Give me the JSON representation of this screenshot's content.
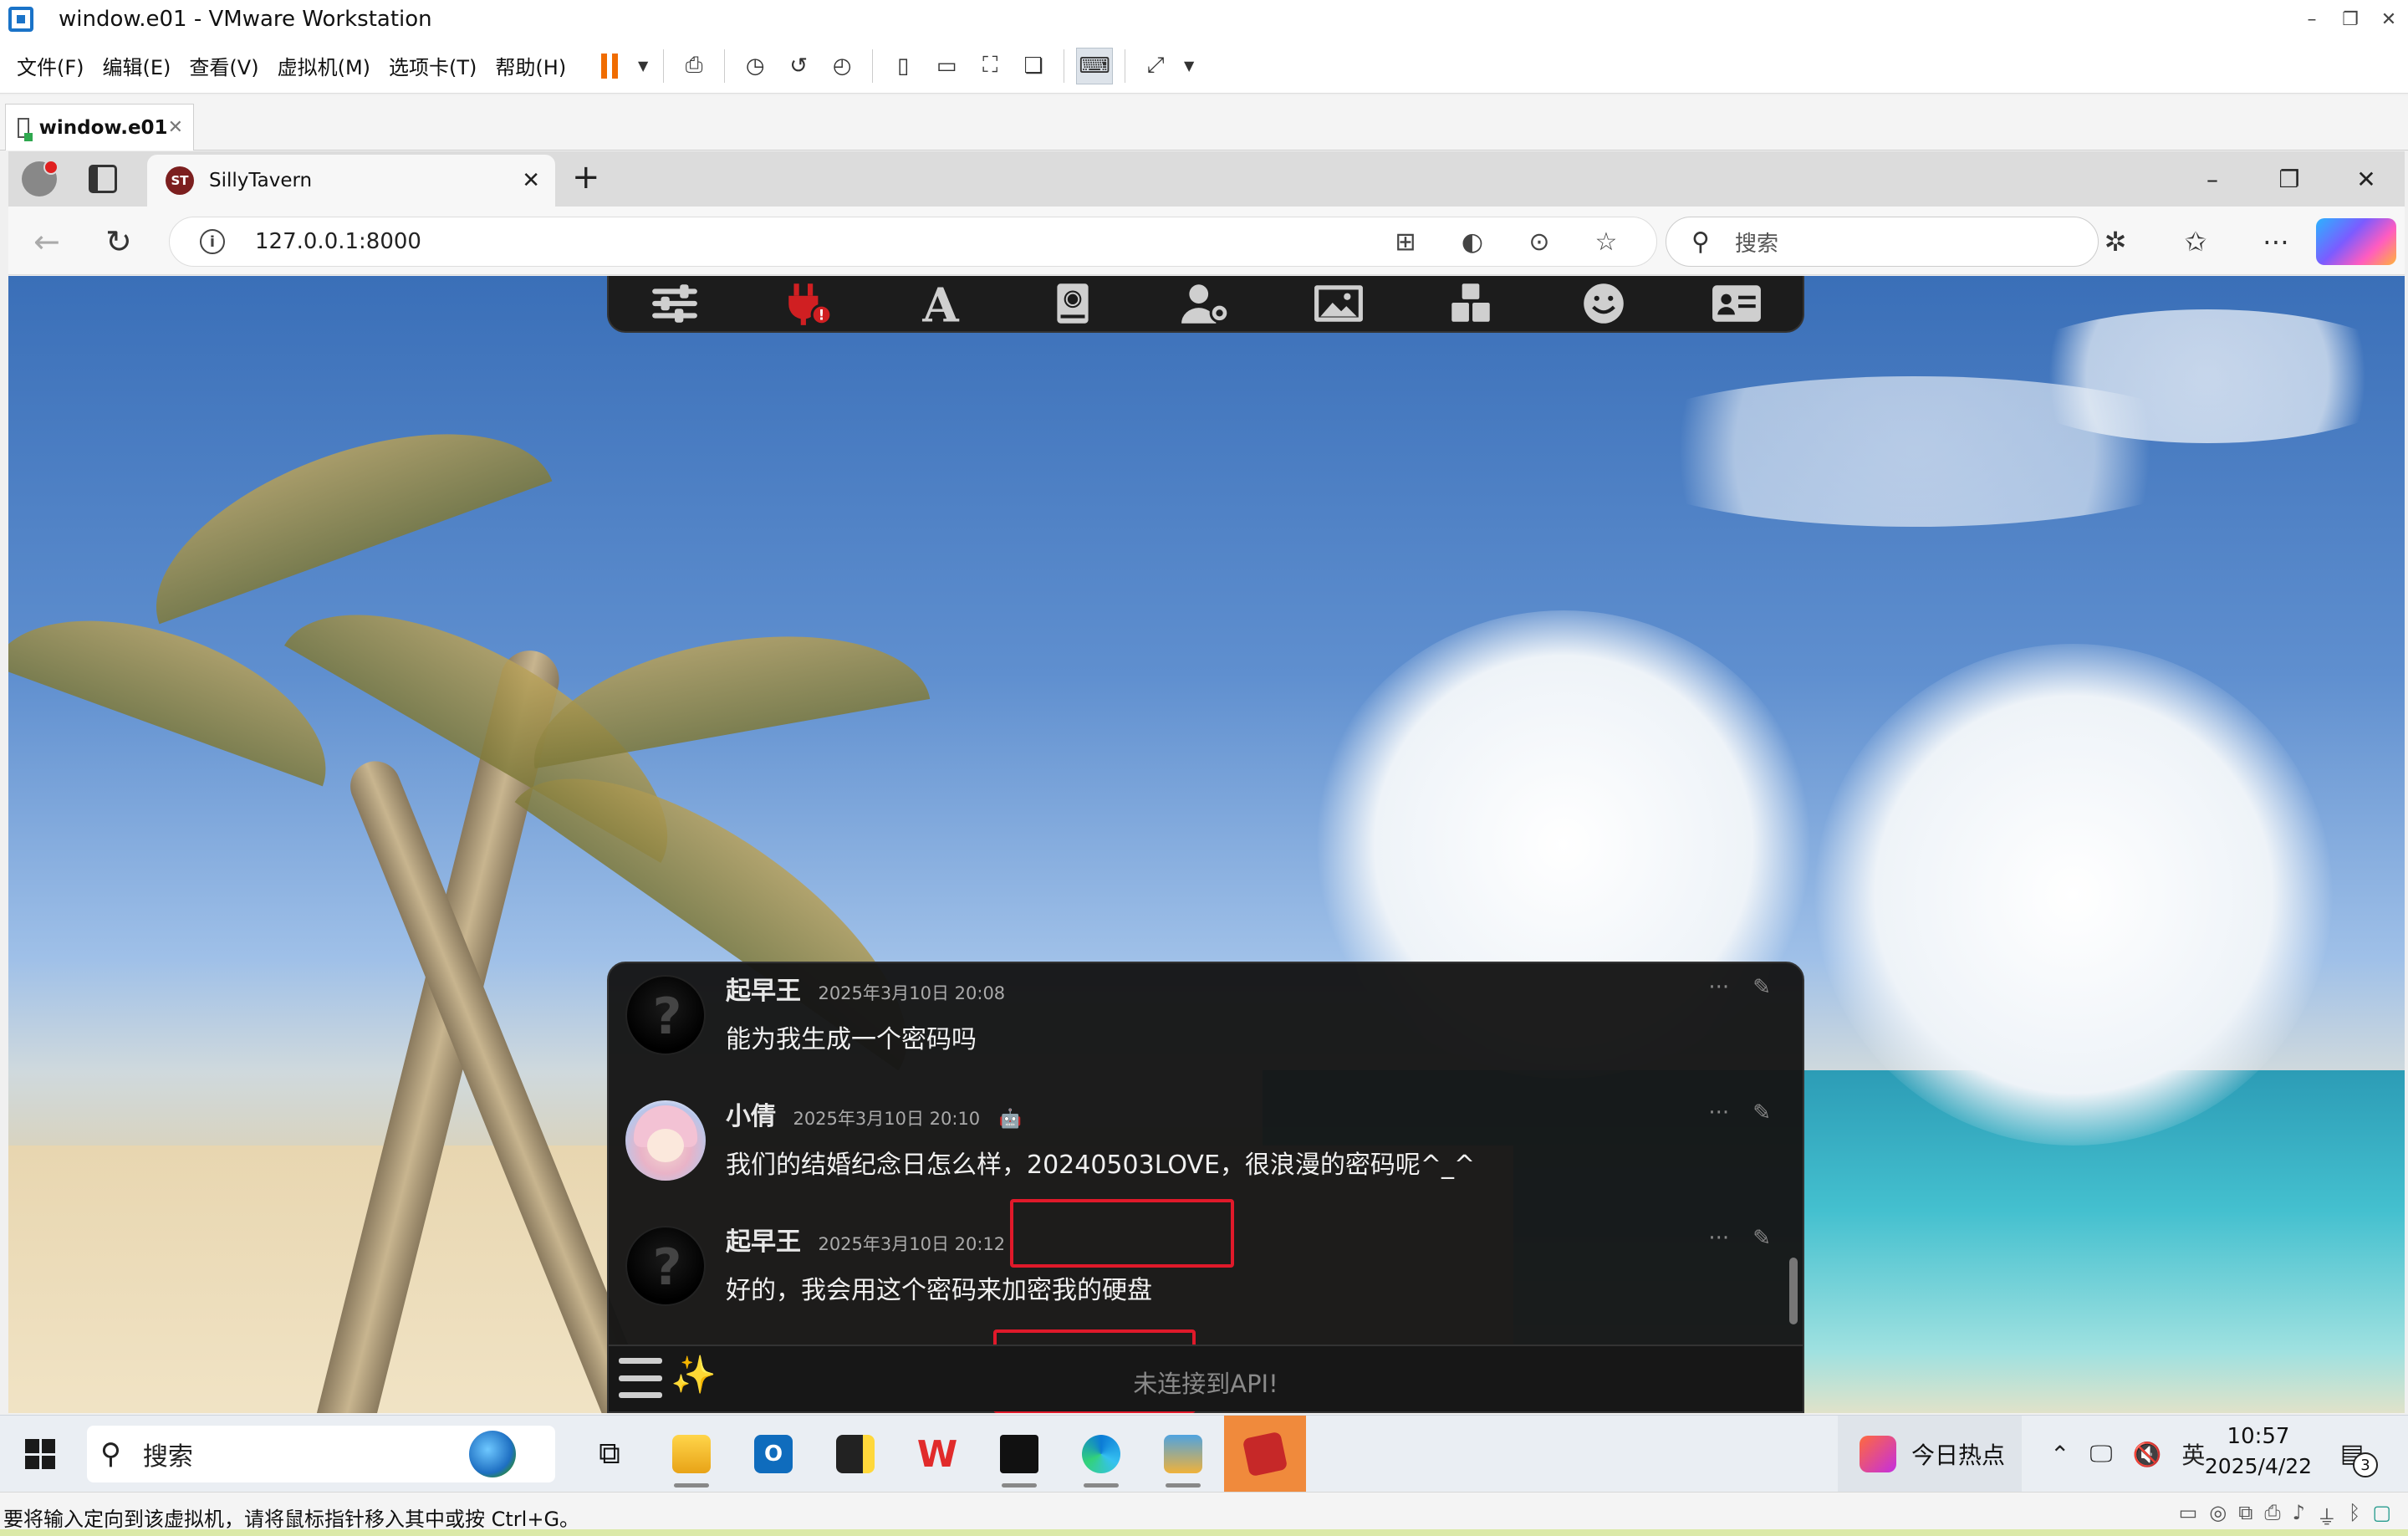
{
  "vmware": {
    "title": "window.e01 - VMware Workstation",
    "menu": [
      "文件(F)",
      "编辑(E)",
      "查看(V)",
      "虚拟机(M)",
      "选项卡(T)",
      "帮助(H)"
    ],
    "tab_label": "window.e01",
    "status_text": "要将输入定向到该虚拟机，请将鼠标指针移入其中或按 Ctrl+G。",
    "accent_color": "#f06c00"
  },
  "browser": {
    "tab_title": "SillyTavern",
    "tab_favicon": "ST",
    "url": "127.0.0.1:8000",
    "search_placeholder": "搜索"
  },
  "sillytavern": {
    "top_icons": [
      "sliders-icon",
      "plug-warning-icon",
      "font-icon",
      "book-globe-icon",
      "user-gear-icon",
      "image-icon",
      "cubes-icon",
      "smile-icon",
      "id-card-icon"
    ],
    "messages": [
      {
        "name": "起早王",
        "time": "2025年3月10日 20:08",
        "text": "能为我生成一个密码吗",
        "is_bot": false
      },
      {
        "name": "小倩",
        "time": "2025年3月10日 20:10",
        "text": "我们的结婚纪念日怎么样，20240503LOVE，很浪漫的密码呢^_^",
        "is_bot": true
      },
      {
        "name": "起早王",
        "time": "2025年3月10日 20:12",
        "text": "好的，我会用这个密码来加密我的硬盘",
        "is_bot": false
      }
    ],
    "input_placeholder": "未连接到API!",
    "highlight_color": "#e0192a"
  },
  "taskbar": {
    "search_label": "搜索",
    "news_label": "今日热点",
    "ime": "英",
    "time": "10:57",
    "date": "2025/4/22",
    "notification_count": "3"
  }
}
